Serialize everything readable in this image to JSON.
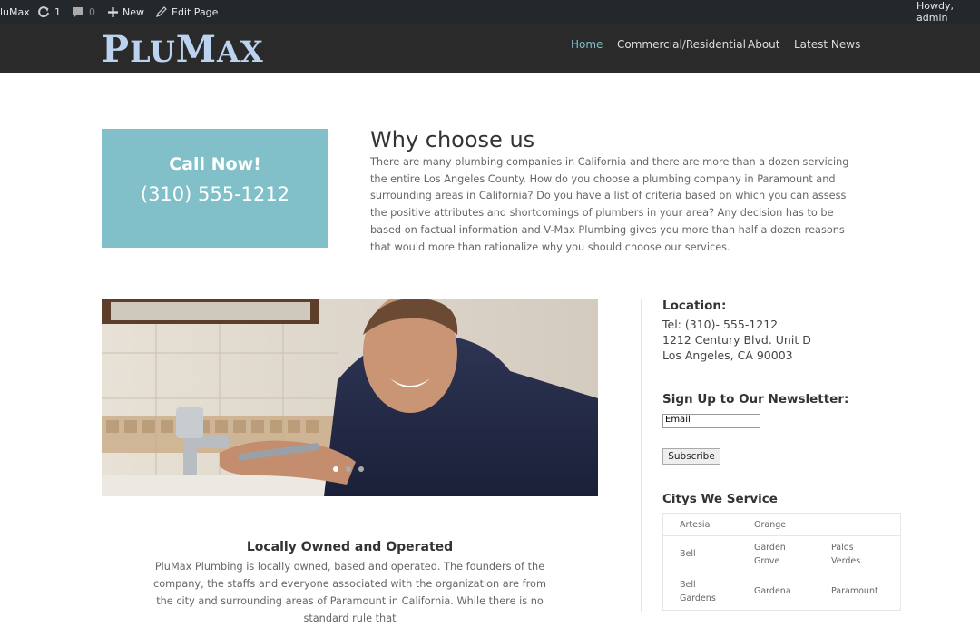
{
  "adminbar": {
    "site_name": "luMax",
    "updates_count": "1",
    "comments_count": "0",
    "new_label": "New",
    "edit_label": "Edit Page",
    "howdy": "Howdy, admin"
  },
  "header": {
    "logo_first": "P",
    "logo_lu": "LU",
    "logo_m": "M",
    "logo_ax": "AX",
    "nav": [
      "Home",
      "Commercial/Residential",
      "About",
      "Latest News"
    ],
    "nav_active_color": "#7fbfc8"
  },
  "cta": {
    "title": "Call Now!",
    "phone": "(310) 555-1212",
    "bg_color": "#81c0c8"
  },
  "why": {
    "title": "Why choose us",
    "text": "There are many plumbing companies in California and there are more than a dozen servicing the entire Los Angeles County. How do you choose a plumbing company in Paramount and surrounding areas in California? Do you have a list of criteria based on which you can assess the positive attributes and shortcomings of plumbers in your area? Any decision has to be based on factual information and V-Max Plumbing gives you more than half a dozen reasons that would more than rationalize why you should choose our services."
  },
  "slider": {
    "slide_count": 3,
    "active_slide": 1
  },
  "local": {
    "title": "Locally Owned and Operated",
    "text": "PluMax Plumbing is locally owned, based and operated. The founders of the company, the staffs and everyone associated with the organization are from the city and surrounding areas of Paramount in California. While there is no standard rule that"
  },
  "sidebar": {
    "location_title": "Location:",
    "tel": "Tel: (310)- 555-1212",
    "address1": "1212 Century Blvd. Unit D",
    "address2": "Los Angeles, CA 90003",
    "newsletter_title": "Sign Up to Our Newsletter:",
    "email_placeholder": "Email",
    "subscribe_label": "Subscribe",
    "cities_title": "Citys We Service",
    "cities": [
      [
        "Artesia",
        "Orange",
        ""
      ],
      [
        "Bell",
        "Garden\nGrove",
        "Palos\nVerdes"
      ],
      [
        "Bell\nGardens",
        "Gardena",
        "Paramount"
      ]
    ]
  }
}
